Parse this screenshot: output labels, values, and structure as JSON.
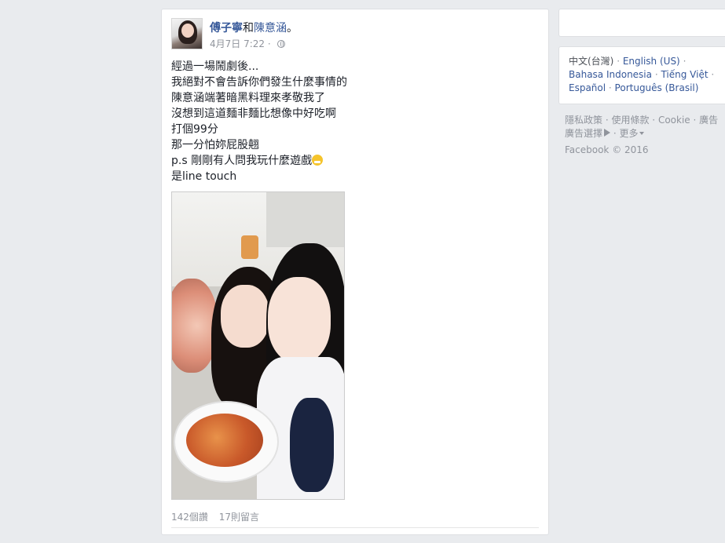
{
  "post": {
    "author": "傅子寧",
    "with_word": "和",
    "tagged": "陳意涵",
    "period": "。",
    "date": "4月7日 7:22",
    "separator": "·",
    "lines": [
      "經過一場鬧劇後...",
      "我絕對不會告訴你們發生什麼事情的",
      "陳意涵端著暗黑料理來孝敬我了",
      "沒想到這道麵非麵比想像中好吃啊",
      "打個99分",
      "那一分怕妳屁股翹",
      "p.s 剛剛有人問我玩什麼遊戲",
      "是line touch"
    ],
    "reads": "142個讚",
    "comments": "17則留言"
  },
  "sidebar": {
    "current_language": "中文(台灣)",
    "languages": [
      "English (US)",
      "Bahasa Indonesia",
      "Tiếng Việt",
      "Español",
      "Português (Brasil)"
    ],
    "footer": {
      "privacy": "隱私政策",
      "terms": "使用條款",
      "cookie": "Cookie",
      "ads": "廣告",
      "adchoices": "廣告選擇",
      "more": "更多"
    },
    "copyright": "Facebook © 2016"
  }
}
